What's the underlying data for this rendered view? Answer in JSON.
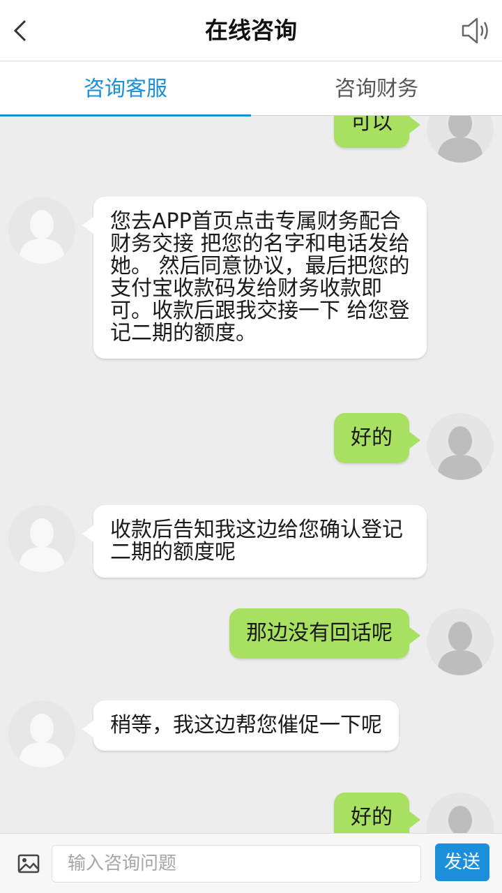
{
  "header": {
    "title": "在线咨询"
  },
  "tabs": [
    {
      "label": "咨询客服",
      "active": true
    },
    {
      "label": "咨询财务",
      "active": false
    }
  ],
  "messages": [
    {
      "from": "user",
      "text": "可以"
    },
    {
      "from": "service",
      "text": "您去APP首页点击专属财务配合财务交接 把您的名字和电话发给她。 然后同意协议，最后把您的支付宝收款码发给财务收款即可。收款后跟我交接一下 给您登记二期的额度。"
    },
    {
      "from": "user",
      "text": "好的"
    },
    {
      "from": "service",
      "text": "收款后告知我这边给您确认登记二期的额度呢"
    },
    {
      "from": "user",
      "text": "那边没有回话呢"
    },
    {
      "from": "service",
      "text": "稍等，我这边帮您催促一下呢"
    },
    {
      "from": "user",
      "text": "好的"
    }
  ],
  "input": {
    "placeholder": "输入咨询问题",
    "value": ""
  },
  "send_label": "发送",
  "colors": {
    "accent": "#1c8fdb",
    "user_bubble": "#a8e061",
    "service_bubble": "#ffffff",
    "background": "#ededed"
  }
}
